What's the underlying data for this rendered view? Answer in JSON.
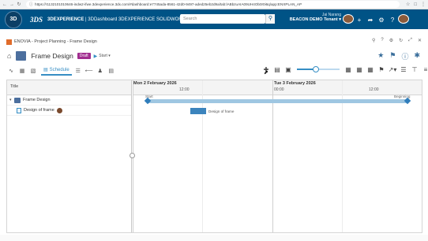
{
  "browser": {
    "url": "https://r1132101010646-indw2-ifwe.3dexperience.3dx.com/#dashboard:e7745ada-8561-42d0-9497-aded25eb2d9a/tab:lABbzuAIA09UH4Ob0r0i6q/app:ENXPLAN_AP"
  },
  "topbar": {
    "compass_label": "3D",
    "logo_text": "3DS",
    "brand_bold": "3DEXPERIENCE",
    "brand_rest": " | 3DDashboard 3DEXPERIENCE SOLIDWORKS",
    "search_placeholder": "Search",
    "user_name": "Jai Narang",
    "tenant": "BEACON DEMO Tenant",
    "accent_color": "#005386"
  },
  "app_header": {
    "title": "ENOVIA - Project Planning - Frame Design"
  },
  "title_row": {
    "page_title": "Frame Design",
    "state_badge": "Draft",
    "start_label": "Start"
  },
  "toolbar": {
    "active_tab": "Schedule",
    "zoom_percent": 45
  },
  "grid": {
    "title_header": "Title",
    "rows": [
      {
        "label": "Frame Design"
      },
      {
        "label": "Design of frame"
      }
    ]
  },
  "gantt": {
    "days": [
      "Mon 2 February 2026",
      "Tue 3 February 2026"
    ],
    "times": [
      "12:00",
      "00:00",
      "12:00"
    ],
    "start_label": "Start",
    "end_label": "Beginning",
    "task_label": "Design of frame"
  }
}
